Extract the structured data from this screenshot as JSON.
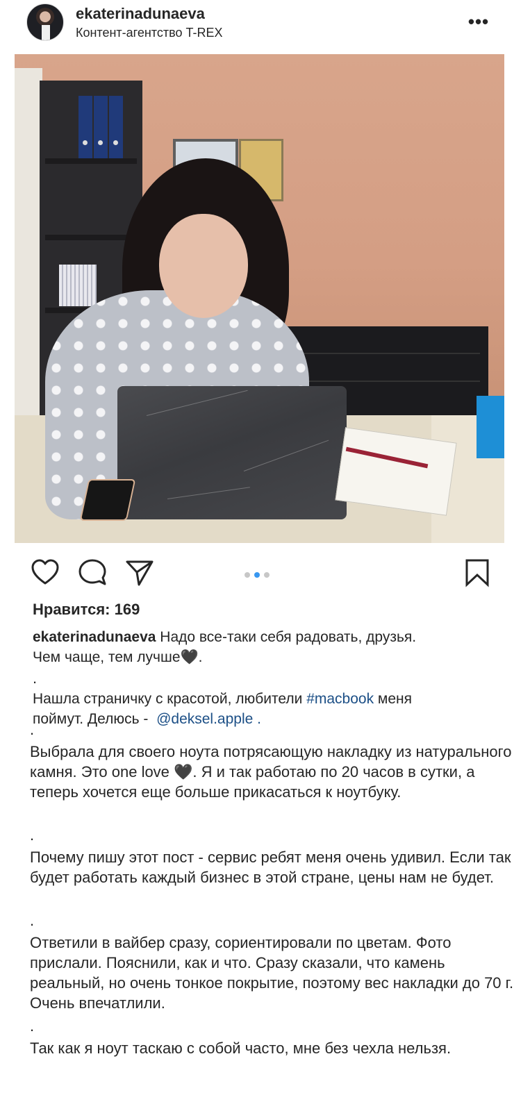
{
  "header": {
    "username": "ekaterinadunaeva",
    "location": "Контент-агентство T-REX",
    "more_icon": "more-horizontal-icon",
    "more_label": "•••"
  },
  "photo": {
    "apple_glyph": ""
  },
  "actions": {
    "like_icon": "heart-icon",
    "comment_icon": "comment-icon",
    "share_icon": "send-icon",
    "save_icon": "bookmark-icon",
    "carousel": {
      "count": 3,
      "active_index": 1
    },
    "accent_color": "#3897f0"
  },
  "likes": {
    "label": "Нравится: 169"
  },
  "caption": {
    "author": "ekaterinadunaeva",
    "line1": " Надо все-таки себя радовать, друзья.",
    "line2": "Чем чаще, тем лучше🖤.",
    "p2_before": "Нашла страничку с красотой, любители ",
    "hashtag": "#macbook",
    "p2_after": " меня",
    "p2_line2_before": "поймут. Делюсь - ",
    "mention": "@deksel.apple",
    "p2_line2_after": " .",
    "tag_color": "#1c4f86"
  },
  "body": {
    "sep": ".",
    "p1": "Выбрала для своего ноута потрясающую накладку из натурального камня. Это one love 🖤. Я и так работаю по 20 часов в сутки, а теперь хочется еще больше прикасаться к ноутбуку.",
    "p2": "Почему пишу этот пост - сервис ребят меня очень удивил. Если так будет работать каждый бизнес в этой стране, цены нам не будет.",
    "p3": "Ответили в вайбер сразу, сориентировали по цветам. Фото прислали. Пояснили, как и что. Сразу сказали, что камень реальный, но очень тонкое покрытие, поэтому вес накладки до 70 г. Очень впечатлили.",
    "p4": "Так как я ноут таскаю с собой часто, мне без чехла нельзя."
  }
}
